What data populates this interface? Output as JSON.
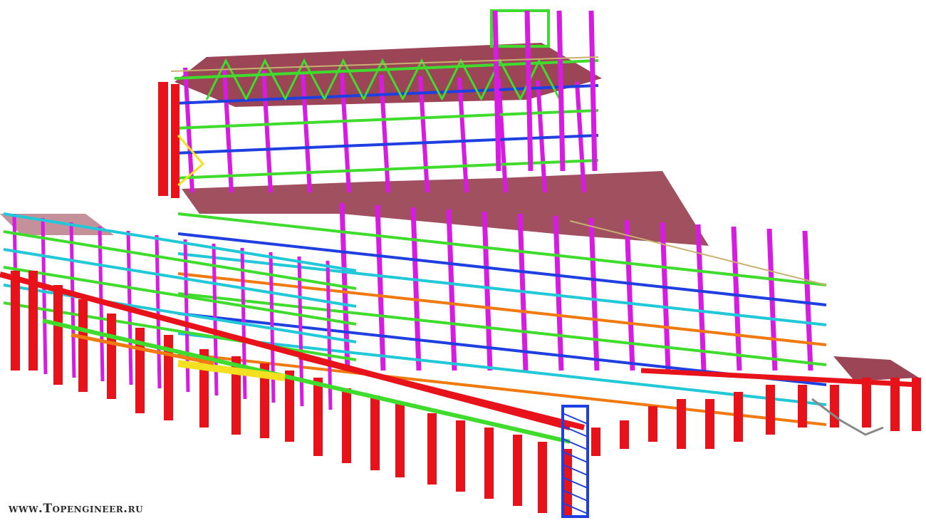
{
  "watermark": "www.Topengineer.ru",
  "palette": {
    "column_red": "#e8121a",
    "column_magenta": "#d61ce0",
    "beam_green": "#3fdc2e",
    "beam_blue": "#1f3fe0",
    "beam_cyan": "#20c8d8",
    "beam_orange": "#f07a10",
    "beam_yellow": "#f4e020",
    "roof_maroon": "#8a2438",
    "rail_tan": "#c8b070"
  }
}
